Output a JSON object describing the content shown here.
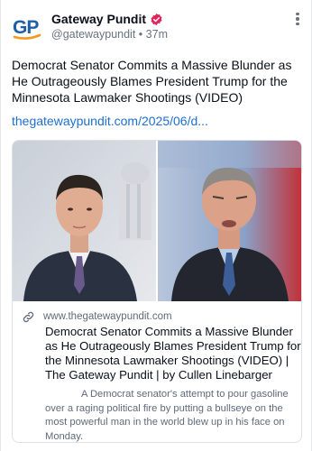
{
  "post": {
    "author_name": "Gateway Pundit",
    "author_handle": "@gatewaypundit",
    "separator": "•",
    "time_ago": "37m",
    "avatar_text": "GP",
    "text": "Democrat Senator Commits a Massive Blunder as He Outrageously Blames President Trump for the Minnesota Lawmaker Shootings (VIDEO)",
    "link_text": "thegatewaypundit.com/2025/06/d..."
  },
  "card": {
    "domain": "www.thegatewaypundit.com",
    "title": "Democrat Senator Commits a Massive Blunder as He Outrageously Blames President Trump for the Minnesota Lawmaker Shootings (VIDEO) | The Gateway Pundit | by Cullen Linebarger",
    "description": "A Democrat senator's attempt to pour gasoline over a raging political fire by putting a bullseye on the most powerful man in the world blew up in his face on Monday."
  },
  "icons": {
    "verified": "verified-badge-icon",
    "more": "more-vertical-icon",
    "link": "link-chain-icon"
  },
  "colors": {
    "link": "#1d6fd1",
    "brand_blue": "#1f5fa8",
    "brand_orange": "#f59b1c",
    "verified": "#e0245e"
  }
}
